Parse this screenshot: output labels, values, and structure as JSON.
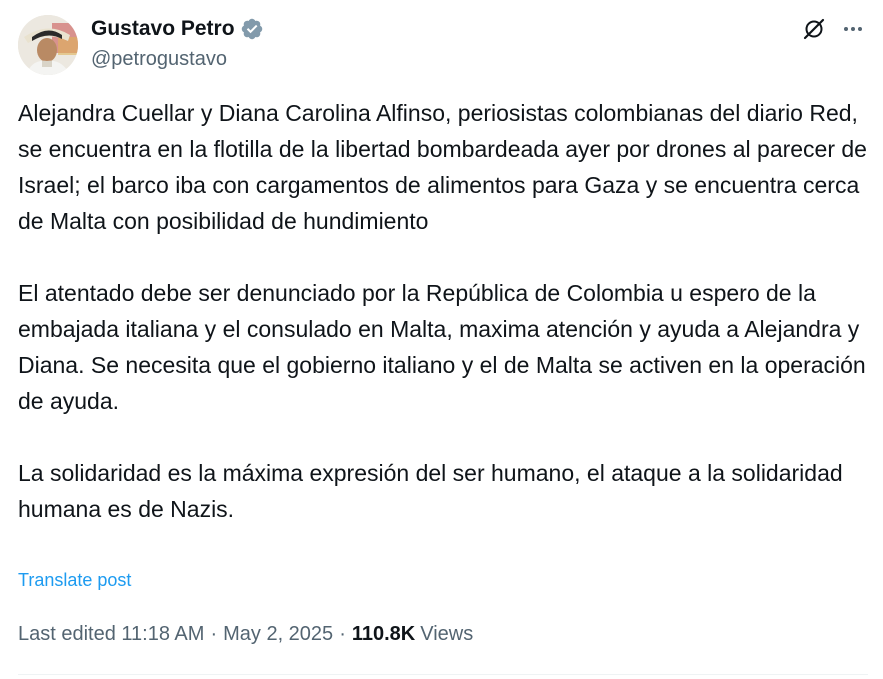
{
  "author": {
    "display_name": "Gustavo Petro",
    "handle": "@petrogustavo",
    "avatar_icon": "profile-photo",
    "verified_icon": "verified-badge-icon",
    "verified_color": "#1d9bf0"
  },
  "header_actions": {
    "grok_icon": "grok-icon",
    "more_icon": "more-options-icon"
  },
  "post": {
    "text": "Alejandra Cuellar y Diana Carolina Alfinso, periosistas colombianas del diario Red, se encuentra en la flotilla de la libertad bombardeada ayer por drones al parecer de Israel; el barco iba con cargamentos de alimentos para Gaza y se encuentra cerca de Malta con posibilidad de hundimiento\n\nEl atentado debe ser denunciado por la República de Colombia u espero de la embajada italiana y el consulado en Malta, maxima atención y ayuda a Alejandra y Diana. Se necesita que el gobierno italiano y el de Malta se activen en la operación de ayuda.\n\nLa solidaridad es la máxima expresión del ser humano, el ataque a la solidaridad humana es de Nazis.",
    "translate_label": "Translate post"
  },
  "meta": {
    "edited_label": "Last edited 11:18 AM",
    "separator": "·",
    "date": "May 2, 2025",
    "views_count": "110.8K",
    "views_label": "Views"
  },
  "colors": {
    "text_primary": "#0f1419",
    "text_secondary": "#536471",
    "link": "#1d9bf0"
  }
}
